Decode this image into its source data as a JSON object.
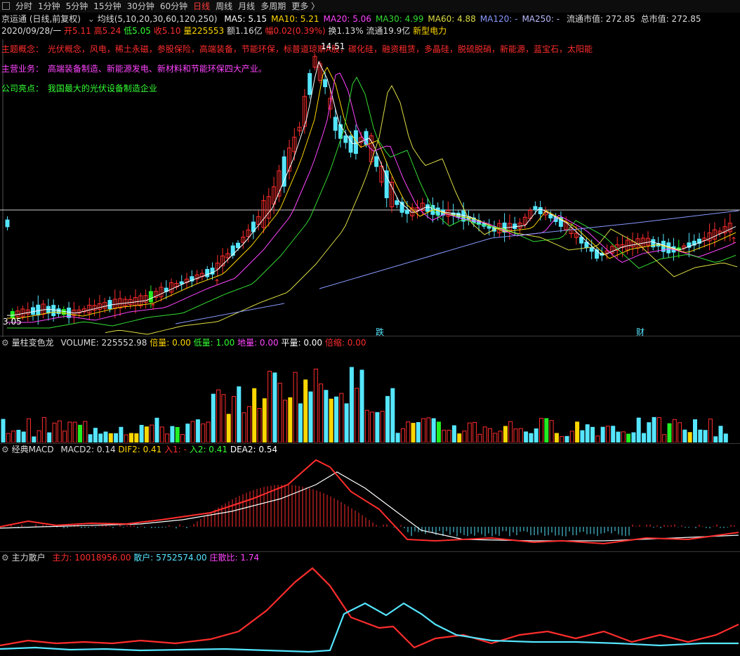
{
  "toolbar": {
    "tabs": [
      "分时",
      "1分钟",
      "5分钟",
      "15分钟",
      "30分钟",
      "60分钟",
      "日线",
      "周线",
      "月线",
      "多周期",
      "更多 〉"
    ],
    "active_index": 6
  },
  "header": {
    "stock": "京运通 (日线,前复权)",
    "ma_label": "均线(5,10,20,30,60,120,250)",
    "ma": [
      {
        "label": "MA5: 5.15",
        "color": "#ffffff"
      },
      {
        "label": "MA10: 5.21",
        "color": "#ffd700"
      },
      {
        "label": "MA20: 5.06",
        "color": "#ff44ff"
      },
      {
        "label": "MA30: 4.99",
        "color": "#33dd33"
      },
      {
        "label": "MA60: 4.88",
        "color": "#dddd44"
      },
      {
        "label": "MA120: -",
        "color": "#8899ff"
      },
      {
        "label": "MA250: -",
        "color": "#bbbbff"
      }
    ],
    "circ_cap": "流通市值: 272.85",
    "total_cap": "总市值: 272.85"
  },
  "quote": {
    "date": "2020/09/28/一",
    "open": "开5.11",
    "high": "高5.24",
    "low": "低5.05",
    "close": "收5.10",
    "vol": "量225553",
    "amount": "额1.16亿",
    "change": "幅0.02(0.39%)",
    "turnover": "换1.13%",
    "float": "流通19.9亿",
    "tag": "新型电力"
  },
  "info": {
    "concept_label": "主题概念：",
    "concept_text": "光伏概念，风电，稀土永磁，参股保险，高端装备，节能环保，标普道琼斯A股，碳化硅，融资租赁，多晶硅，脱硫脱硝，新能源，蓝宝石，太阳能",
    "business_label": "主营业务：",
    "business_text": "高端装备制造、新能源发电、新材料和节能环保四大产业。",
    "highlight_label": "公司亮点：",
    "highlight_text": "我国最大的光伏设备制造企业"
  },
  "price_chart": {
    "high_label": "14.51",
    "low_label": "3.05",
    "mark_die": "跌",
    "mark_cai": "财"
  },
  "volume_panel": {
    "name": "量柱变色龙",
    "volume": "VOLUME: 225552.98",
    "beiliang": "倍量: 0.00",
    "diliang": "低量: 1.00",
    "diliang2": "地量: 0.00",
    "pingliang": "平量: 0.00",
    "beisuo": "倍缩: 0.00"
  },
  "macd_panel": {
    "name": "经典MACD",
    "macd": "MACD2: 0.14",
    "dif": "DIF2: 0.41",
    "in1": "入1: -",
    "in2": "入2: 0.41",
    "dea": "DEA2: 0.54"
  },
  "flow_panel": {
    "name": "主力散户",
    "main": "主力: 10018956.00",
    "retail": "散户: 5752574.00",
    "ratio": "庄散比: 1.74"
  },
  "colors": {
    "up": "#ff2d2d",
    "down_cyan": "#55e6ff",
    "down_green": "#22ee22",
    "ma5": "#ffffff",
    "ma10": "#ffd700",
    "ma20": "#ff44ff",
    "ma30": "#33dd33",
    "ma60": "#dddd44",
    "ma120": "#8899ff"
  }
}
